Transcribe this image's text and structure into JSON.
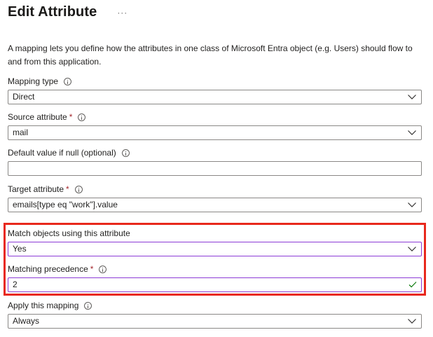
{
  "header": {
    "title": "Edit Attribute",
    "more_label": "···"
  },
  "description": "A mapping lets you define how the attributes in one class of Microsoft Entra object (e.g. Users) should flow to and from this application.",
  "fields": {
    "mapping_type": {
      "label": "Mapping type",
      "value": "Direct",
      "required": false
    },
    "source_attribute": {
      "label": "Source attribute",
      "value": "mail",
      "required": true
    },
    "default_value": {
      "label": "Default value if null (optional)",
      "value": "",
      "required": false
    },
    "target_attribute": {
      "label": "Target attribute",
      "value": "emails[type eq \"work\"].value",
      "required": true
    },
    "match_objects": {
      "label": "Match objects using this attribute",
      "value": "Yes",
      "required": false
    },
    "matching_precedence": {
      "label": "Matching precedence",
      "value": "2",
      "required": true
    },
    "apply_mapping": {
      "label": "Apply this mapping",
      "value": "Always",
      "required": false
    }
  },
  "required_marker": "*",
  "colors": {
    "highlight_border": "#e8281c",
    "focus_border": "#8c3bd6",
    "required": "#a4262c",
    "valid_check": "#107c10"
  },
  "icons": {
    "info": "info-icon",
    "dropdown": "chevron-down-icon",
    "valid": "checkmark-icon"
  }
}
